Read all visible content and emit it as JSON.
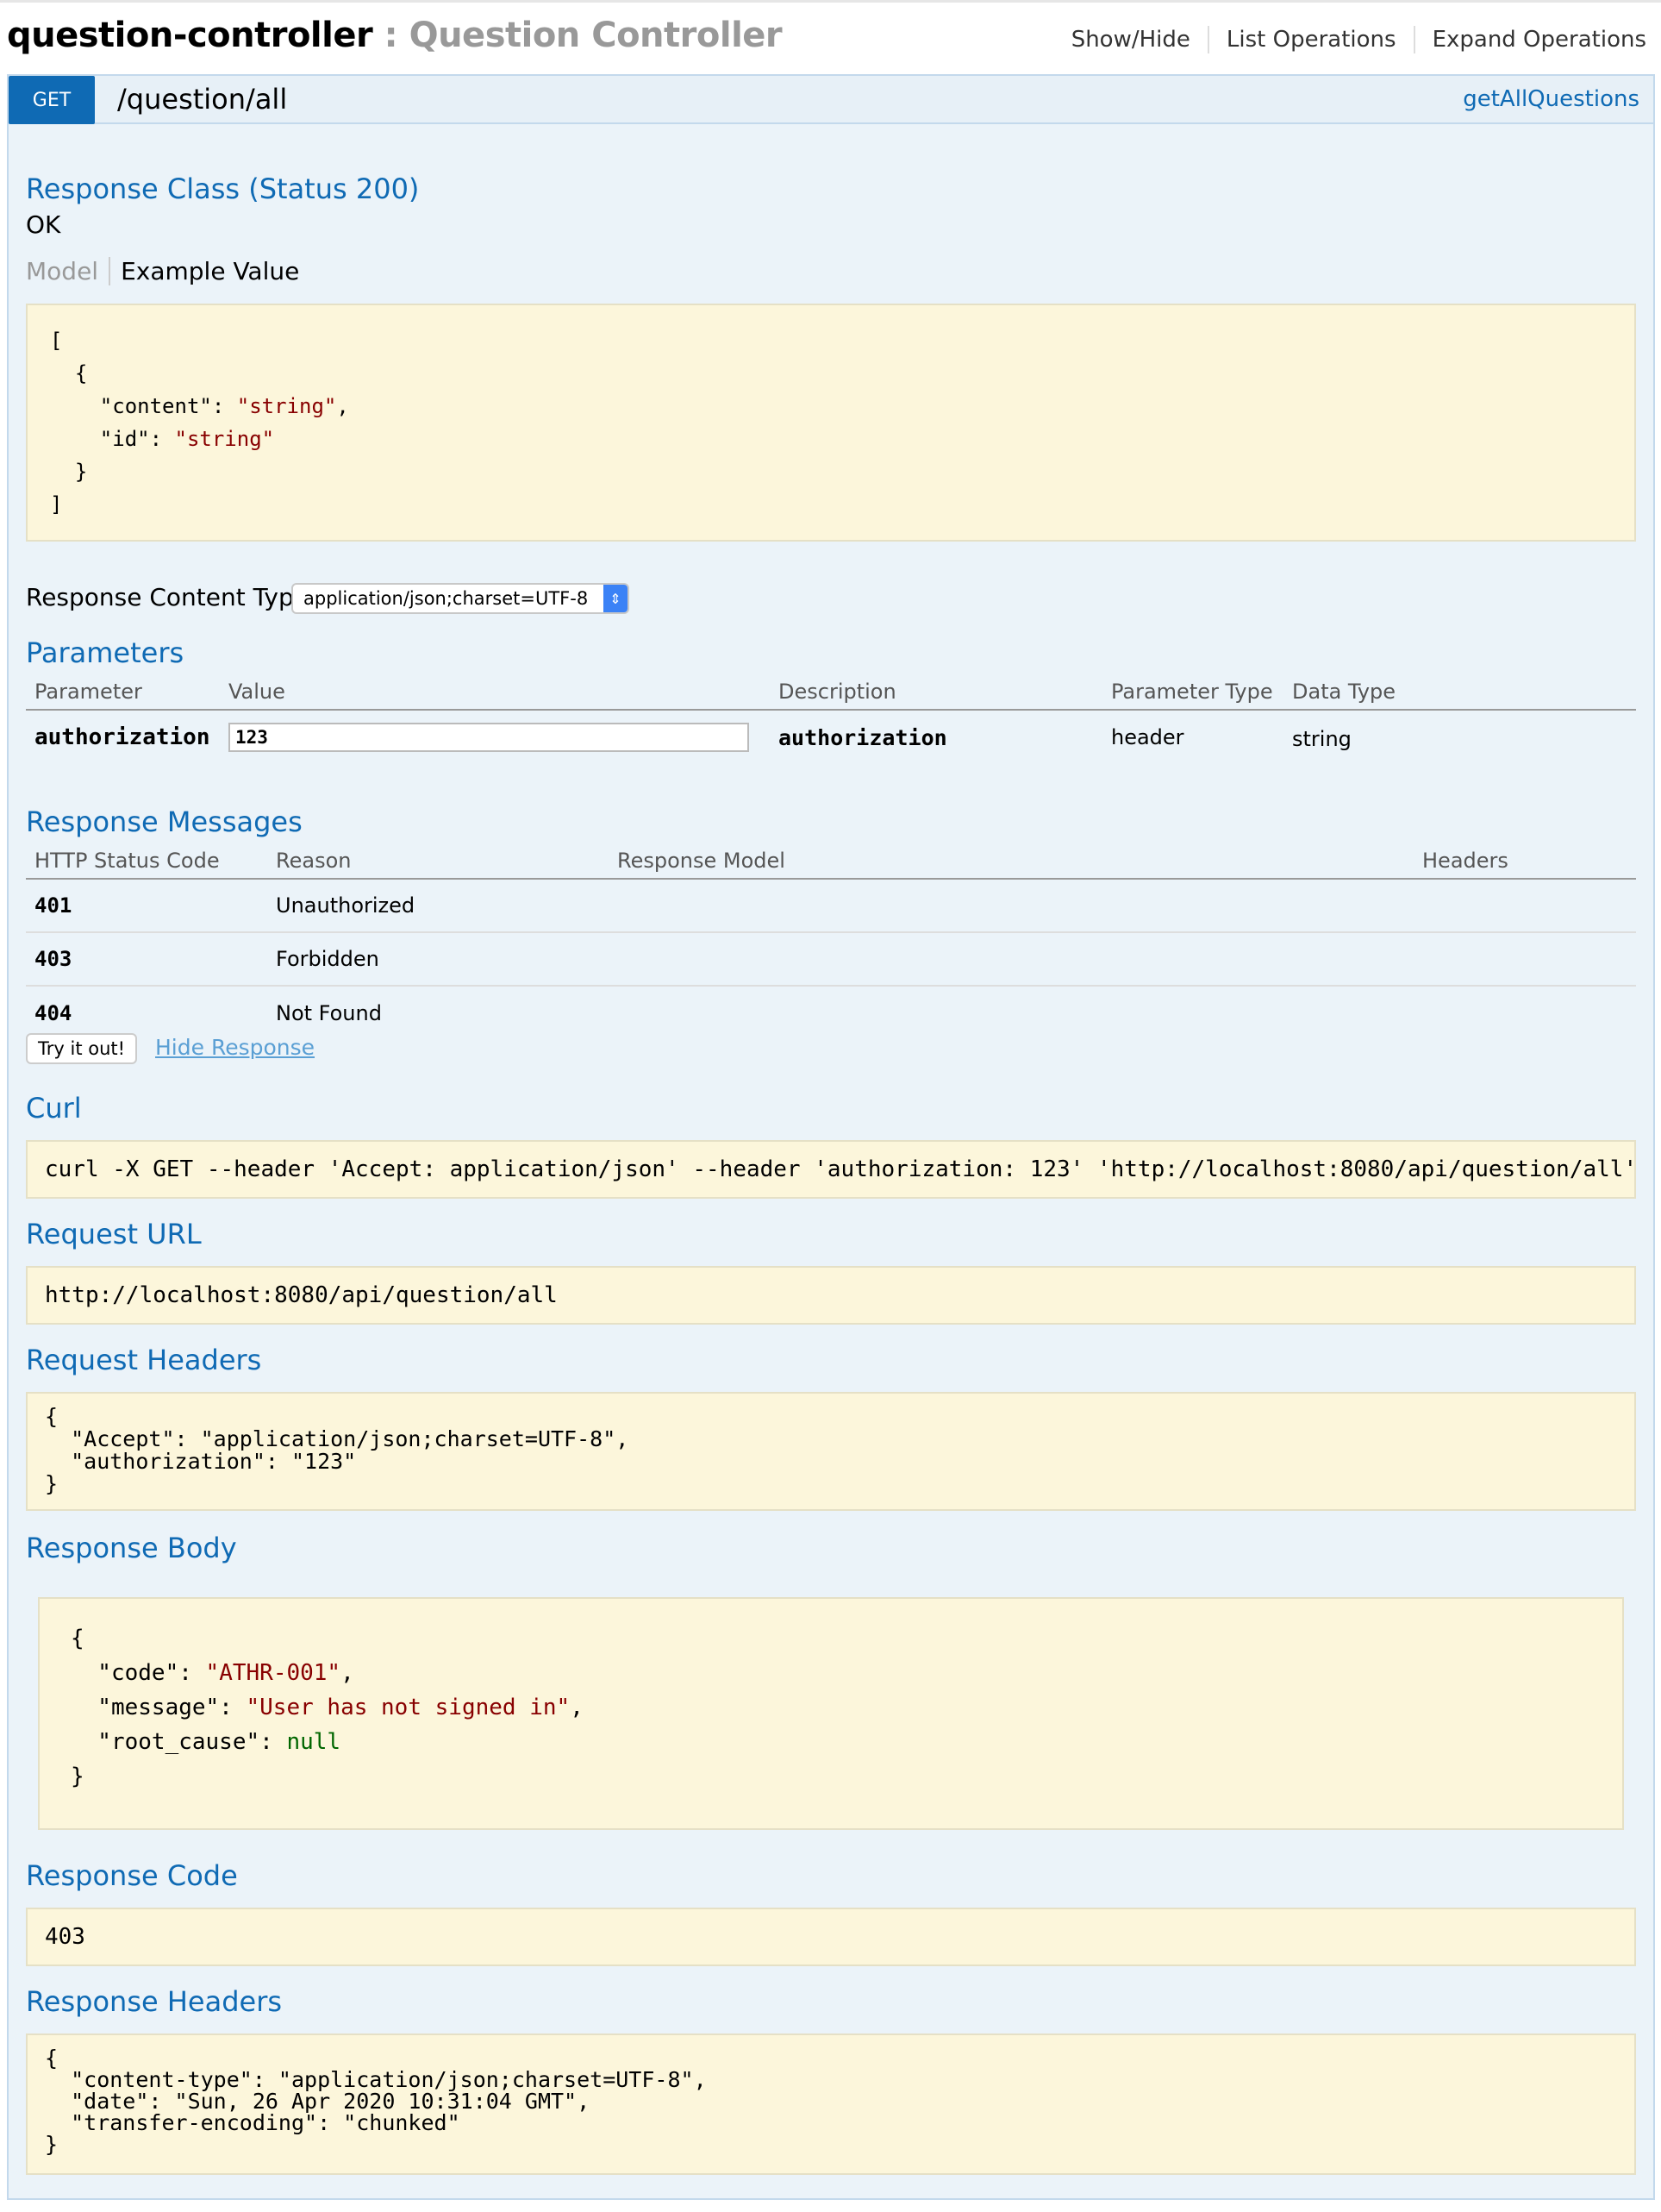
{
  "header": {
    "controller_name": "question-controller",
    "separator": " : ",
    "controller_description": "Question Controller",
    "links": [
      "Show/Hide",
      "List Operations",
      "Expand Operations"
    ]
  },
  "operation": {
    "method": "GET",
    "path": "/question/all",
    "nickname": "getAllQuestions"
  },
  "response_class": {
    "heading": "Response Class (Status 200)",
    "status_text": "OK",
    "tab_model": "Model",
    "tab_example": "Example Value",
    "example_lines": [
      [
        {
          "t": "["
        }
      ],
      [
        {
          "t": "  {"
        }
      ],
      [
        {
          "t": "    \"content\": "
        },
        {
          "t": "\"string\"",
          "c": "str"
        },
        {
          "t": ","
        }
      ],
      [
        {
          "t": "    \"id\": "
        },
        {
          "t": "\"string\"",
          "c": "str"
        }
      ],
      [
        {
          "t": "  }"
        }
      ],
      [
        {
          "t": "]"
        }
      ]
    ]
  },
  "content_type": {
    "label": "Response Content Type",
    "selected": "application/json;charset=UTF-8"
  },
  "parameters": {
    "heading": "Parameters",
    "columns": [
      "Parameter",
      "Value",
      "Description",
      "Parameter Type",
      "Data Type"
    ],
    "rows": [
      {
        "name": "authorization",
        "value": "123",
        "description": "authorization",
        "param_type": "header",
        "data_type": "string"
      }
    ]
  },
  "response_messages": {
    "heading": "Response Messages",
    "columns": [
      "HTTP Status Code",
      "Reason",
      "Response Model",
      "Headers"
    ],
    "rows": [
      {
        "code": "401",
        "reason": "Unauthorized"
      },
      {
        "code": "403",
        "reason": "Forbidden"
      },
      {
        "code": "404",
        "reason": "Not Found"
      }
    ]
  },
  "actions": {
    "try_label": "Try it out!",
    "hide_label": "Hide Response"
  },
  "curl": {
    "heading": "Curl",
    "command": "curl -X GET --header 'Accept: application/json' --header 'authorization: 123' 'http://localhost:8080/api/question/all'"
  },
  "request_url": {
    "heading": "Request URL",
    "url": "http://localhost:8080/api/question/all"
  },
  "request_headers": {
    "heading": "Request Headers",
    "body": "{\n  \"Accept\": \"application/json;charset=UTF-8\",\n  \"authorization\": \"123\"\n}"
  },
  "response_body": {
    "heading": "Response Body",
    "lines": [
      [
        {
          "t": "{"
        }
      ],
      [
        {
          "t": "  \"code\": "
        },
        {
          "t": "\"ATHR-001\"",
          "c": "str"
        },
        {
          "t": ","
        }
      ],
      [
        {
          "t": "  \"message\": "
        },
        {
          "t": "\"User has not signed in\"",
          "c": "str"
        },
        {
          "t": ","
        }
      ],
      [
        {
          "t": "  \"root_cause\": "
        },
        {
          "t": "null",
          "c": "lit"
        }
      ],
      [
        {
          "t": "}"
        }
      ]
    ]
  },
  "response_code": {
    "heading": "Response Code",
    "value": "403"
  },
  "response_headers": {
    "heading": "Response Headers",
    "body": "{\n  \"content-type\": \"application/json;charset=UTF-8\",\n  \"date\": \"Sun, 26 Apr 2020 10:31:04 GMT\",\n  \"transfer-encoding\": \"chunked\"\n}"
  },
  "colors": {
    "accent_blue": "#0f6ab4",
    "panel_bg": "#ebf3f9",
    "code_bg": "#fcf6db",
    "string_red": "#880000",
    "literal_green": "#006600"
  }
}
